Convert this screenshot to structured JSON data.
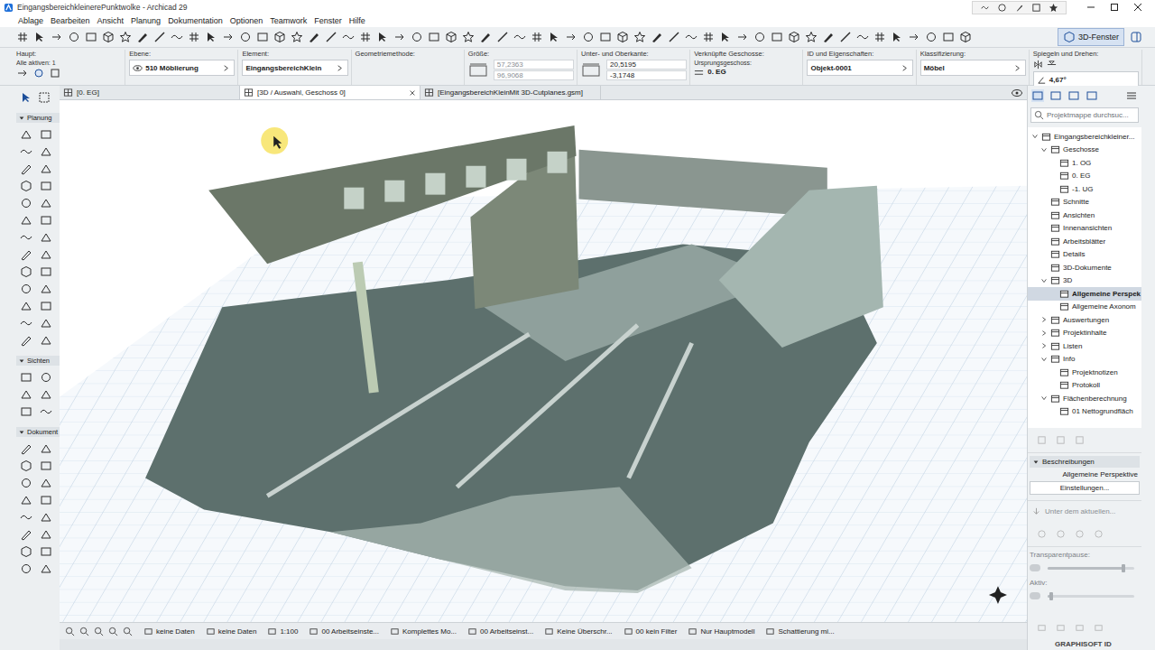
{
  "window": {
    "title": "EingangsbereichkleinerePunktwolke - Archicad 29"
  },
  "menu": [
    "Ablage",
    "Bearbeiten",
    "Ansicht",
    "Planung",
    "Dokumentation",
    "Optionen",
    "Teamwork",
    "Fenster",
    "Hilfe"
  ],
  "toolbar": {
    "view_button": {
      "label": "3D-Fenster",
      "selected": true
    }
  },
  "infobox": [
    {
      "label": "Haupt:",
      "kind": "icons",
      "values": [
        "Alle aktiven: 1"
      ],
      "disabled": false
    },
    {
      "label": "Ebene:",
      "kind": "field",
      "values": [
        "510 Möblierung"
      ],
      "disabled": false
    },
    {
      "label": "Element:",
      "kind": "field",
      "values": [
        "EingangsbereichKlein"
      ],
      "disabled": false
    },
    {
      "label": "Geometriemethode:",
      "kind": "empty",
      "values": [],
      "disabled": true
    },
    {
      "label": "Größe:",
      "kind": "stack",
      "values": [
        "57,2363",
        "96,9068"
      ],
      "disabled": true
    },
    {
      "label": "Unter- und Oberkante:",
      "kind": "stack",
      "values": [
        "20,5195",
        "-3,1748"
      ],
      "disabled": false
    },
    {
      "label": "Verknüpfte Geschosse:",
      "kind": "linked",
      "sublabel": "Ursprungsgeschoss:",
      "values": [
        "0. EG"
      ],
      "disabled": false
    },
    {
      "label": "ID und Eigenschaften:",
      "kind": "field",
      "values": [
        "Objekt-0001"
      ],
      "disabled": false
    },
    {
      "label": "Klassifizierung:",
      "kind": "field",
      "values": [
        "Möbel"
      ],
      "disabled": false
    },
    {
      "label": "Spiegeln und Drehen:",
      "kind": "angle",
      "values": [
        "4,67°"
      ],
      "disabled": false
    }
  ],
  "tabs": [
    {
      "label": "[0. EG]",
      "selected": false
    },
    {
      "label": "[3D / Auswahl, Geschoss 0]",
      "selected": true
    },
    {
      "label": "[EingangsbereichKleinMit 3D-Cutplanes.gsm]",
      "selected": false
    }
  ],
  "toolbox": [
    {
      "label": "Planung",
      "expanded": true
    },
    {
      "label": "Sichten",
      "expanded": true
    },
    {
      "label": "Dokument",
      "expanded": true
    }
  ],
  "navigator": {
    "search": {
      "placeholder": "Projektmappe durchsuc..."
    },
    "tree": [
      {
        "label": "Eingangsbereichkleiner...",
        "selected": false,
        "expanded": true,
        "children": [
          {
            "label": "Geschosse",
            "selected": false,
            "expanded": true,
            "children": [
              {
                "label": "1. OG",
                "selected": false
              },
              {
                "label": "0. EG",
                "selected": false
              },
              {
                "label": "-1. UG",
                "selected": false
              }
            ]
          },
          {
            "label": "Schnitte",
            "selected": false
          },
          {
            "label": "Ansichten",
            "selected": false
          },
          {
            "label": "Innenansichten",
            "selected": false
          },
          {
            "label": "Arbeitsblätter",
            "selected": false
          },
          {
            "label": "Details",
            "selected": false
          },
          {
            "label": "3D-Dokumente",
            "selected": false
          },
          {
            "label": "3D",
            "selected": false,
            "expanded": true,
            "children": [
              {
                "label": "Allgemeine Perspek",
                "selected": true
              },
              {
                "label": "Allgemeine Axonom",
                "selected": false
              }
            ]
          },
          {
            "label": "Auswertungen",
            "selected": false,
            "expanded": false,
            "children": []
          },
          {
            "label": "Projektinhalte",
            "selected": false,
            "expanded": false,
            "children": []
          },
          {
            "label": "Listen",
            "selected": false,
            "expanded": false,
            "children": []
          },
          {
            "label": "Info",
            "selected": false,
            "expanded": true,
            "children": [
              {
                "label": "Projektnotizen",
                "selected": false
              },
              {
                "label": "Protokoll",
                "selected": false
              }
            ]
          },
          {
            "label": "Flächenberechnung",
            "selected": false,
            "expanded": true,
            "children": [
              {
                "label": "01 Nettogrundfläch",
                "selected": false
              }
            ]
          }
        ]
      }
    ],
    "descriptions": {
      "header": "Beschreibungen",
      "expanded": true,
      "value": "Allgemeine Perspektive",
      "button": "Einstellungen..."
    },
    "save_under": {
      "label": "Unter dem aktuellen...",
      "disabled": true
    },
    "sliders": [
      {
        "label": "Transparentpause:",
        "level": 0.88,
        "disabled": true
      },
      {
        "label": "Aktiv:",
        "level": 0.04,
        "disabled": true
      }
    ],
    "account": "GRAPHISOFT ID"
  },
  "status_bar": [
    "keine Daten",
    "keine Daten",
    "1:100",
    "00 Arbeitseinste...",
    "Komplettes Mo...",
    "00 Arbeitseinst...",
    "Keine Überschr...",
    "00 kein Filter",
    "Nur Hauptmodell",
    "Schattierung mi..."
  ]
}
